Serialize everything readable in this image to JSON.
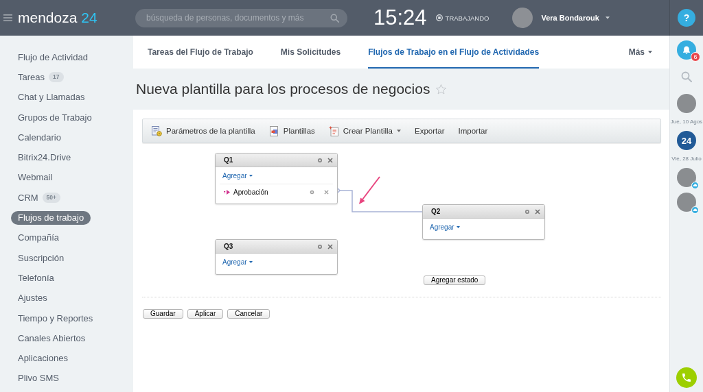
{
  "header": {
    "logo": {
      "name": "mendoza",
      "number": "24"
    },
    "search": {
      "placeholder": "búsqueda de personas, documentos y más"
    },
    "clock": "15:24",
    "work_status": "TRABAJANDO",
    "user": {
      "name": "Vera Bondarouk"
    },
    "help": "?"
  },
  "sidebar": {
    "items": [
      {
        "label": "Flujo de Actividad",
        "selected": false
      },
      {
        "label": "Tareas",
        "badge": "17",
        "selected": false
      },
      {
        "label": "Chat y Llamadas",
        "selected": false
      },
      {
        "label": "Grupos de Trabajo",
        "selected": false
      },
      {
        "label": "Calendario",
        "selected": false
      },
      {
        "label": "Bitrix24.Drive",
        "selected": false
      },
      {
        "label": "Webmail",
        "selected": false
      },
      {
        "label": "CRM",
        "badge": "50+",
        "selected": false
      },
      {
        "label": "Flujos de trabajo",
        "selected": true
      },
      {
        "label": "Compañía",
        "selected": false
      },
      {
        "label": "Suscripción",
        "selected": false
      },
      {
        "label": "Telefonía",
        "selected": false
      },
      {
        "label": "Ajustes",
        "selected": false
      },
      {
        "label": "Tiempo y Reportes",
        "selected": false
      },
      {
        "label": "Canales Abiertos",
        "selected": false
      },
      {
        "label": "Aplicaciones",
        "selected": false
      },
      {
        "label": "Plivo SMS",
        "selected": false
      }
    ]
  },
  "tabs": {
    "items": [
      {
        "label": "Tareas del Flujo de Trabajo",
        "selected": false
      },
      {
        "label": "Mis Solicitudes",
        "selected": false
      },
      {
        "label": "Flujos de Trabajo en el Flujo de Actividades",
        "selected": true
      }
    ],
    "more": "Más"
  },
  "page": {
    "title": "Nueva plantilla para los procesos de negocios",
    "favorite": false
  },
  "toolbar": [
    {
      "label": "Parámetros de la plantilla",
      "kind": "settings",
      "dropdown": false
    },
    {
      "label": "Plantillas",
      "kind": "templates",
      "dropdown": false
    },
    {
      "label": "Crear Plantilla",
      "kind": "create",
      "dropdown": true
    },
    {
      "label": "Exportar",
      "kind": "plain",
      "dropdown": false
    },
    {
      "label": "Importar",
      "kind": "plain",
      "dropdown": false
    }
  ],
  "designer": {
    "states": [
      {
        "title": "Q1",
        "add_label": "Agregar",
        "activities": [
          {
            "label": "Aprobación"
          }
        ]
      },
      {
        "title": "Q2",
        "add_label": "Agregar"
      },
      {
        "title": "Q3",
        "add_label": "Agregar"
      }
    ],
    "add_state_button": "Agregar estado"
  },
  "actions": [
    "Guardar",
    "Aplicar",
    "Cancelar"
  ],
  "right_panel": {
    "notifications": "6",
    "recent": [
      {
        "kind": "avatar",
        "online": false
      },
      {
        "kind": "date",
        "label": "Jue, 10 Agos"
      },
      {
        "kind": "logo",
        "label": "24"
      },
      {
        "kind": "date",
        "label": "Vie, 28 Julio"
      },
      {
        "kind": "avatar",
        "online": true
      },
      {
        "kind": "avatar",
        "online": true
      }
    ]
  }
}
